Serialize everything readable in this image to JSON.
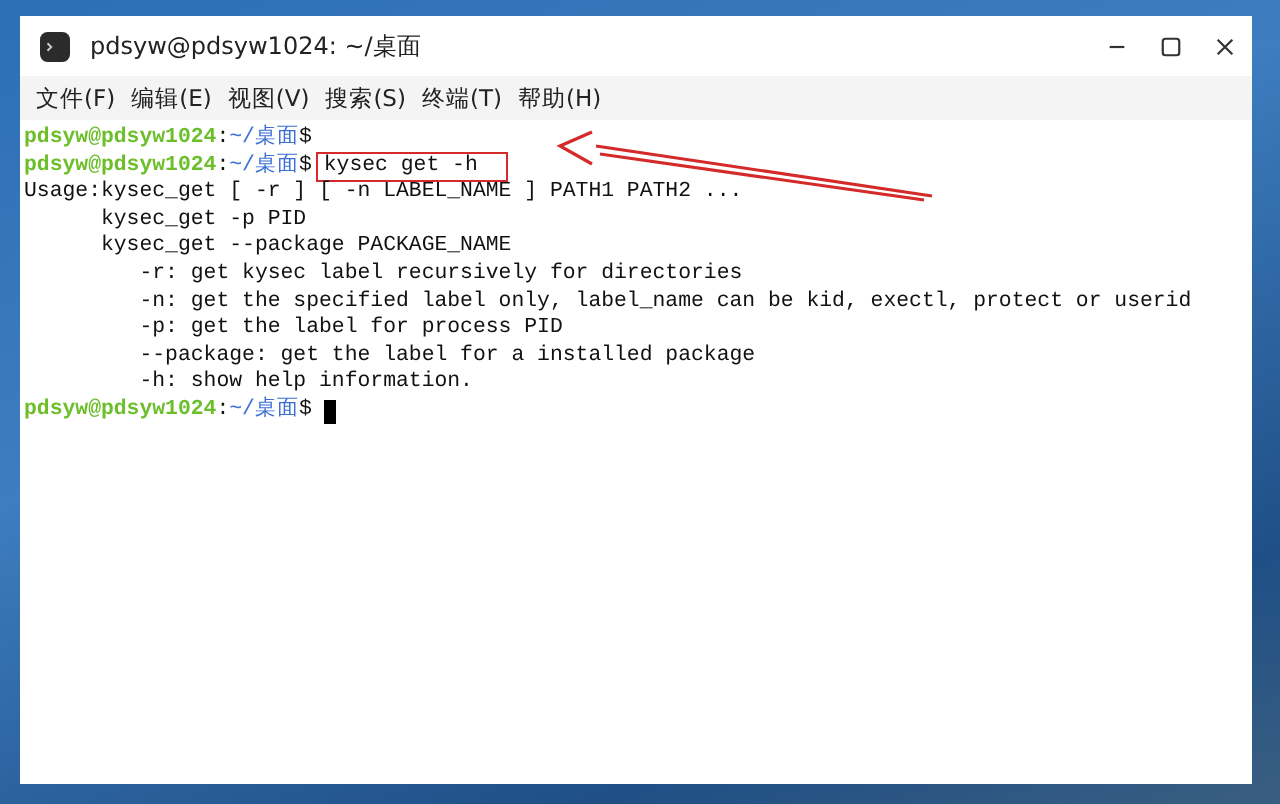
{
  "window": {
    "title": "pdsyw@pdsyw1024: ~/桌面"
  },
  "menu": [
    "文件(F)",
    "编辑(E)",
    "视图(V)",
    "搜索(S)",
    "终端(T)",
    "帮助(H)"
  ],
  "terminal": {
    "lines": [
      {
        "kind": "prompt",
        "user": "pdsyw@pdsyw1024",
        "sep": ":",
        "path": "~/桌面",
        "sign": "$",
        "highlighted": false,
        "cursor": false
      },
      {
        "kind": "prompt",
        "user": "pdsyw@pdsyw1024",
        "sep": ":",
        "path": "~/桌面",
        "sign": "$",
        "command": "kysec get -h",
        "highlighted": true,
        "cursor": false
      },
      {
        "kind": "output",
        "text": "Usage:kysec_get [ -r ] [ -n LABEL_NAME ] PATH1 PATH2 ..."
      },
      {
        "kind": "output",
        "text": "      kysec_get -p PID"
      },
      {
        "kind": "output",
        "text": "      kysec_get --package PACKAGE_NAME"
      },
      {
        "kind": "output",
        "text": "         -r: get kysec label recursively for directories"
      },
      {
        "kind": "output",
        "text": "         -n: get the specified label only, label_name can be kid, exectl, protect or userid"
      },
      {
        "kind": "output",
        "text": "         -p: get the label for process PID"
      },
      {
        "kind": "output",
        "text": "         --package: get the label for a installed package"
      },
      {
        "kind": "output",
        "text": "         -h: show help information."
      },
      {
        "kind": "prompt",
        "user": "pdsyw@pdsyw1024",
        "sep": ":",
        "path": "~/桌面",
        "sign": "$",
        "highlighted": false,
        "cursor": true
      }
    ]
  }
}
